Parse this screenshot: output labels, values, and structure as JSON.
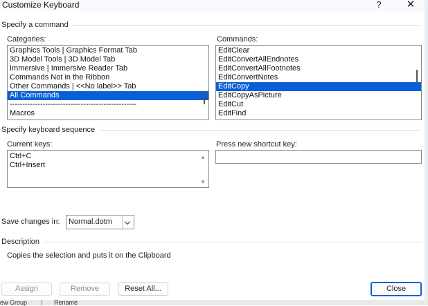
{
  "window": {
    "title": "Customize Keyboard",
    "help_glyph": "?",
    "close_glyph": "✕"
  },
  "specify_command": {
    "heading": "Specify a command",
    "categories_label": "Categories:",
    "categories": [
      "Graphics Tools | Graphics Format Tab",
      "3D Model Tools | 3D Model Tab",
      "Immersive | Immersive Reader Tab",
      "Commands Not in the Ribbon",
      "Other Commands | <<No label>> Tab",
      "All Commands",
      "--------------------------------------------------",
      "Macros"
    ],
    "categories_selected_index": 5,
    "commands_label": "Commands:",
    "commands": [
      "EditClear",
      "EditConvertAllEndnotes",
      "EditConvertAllFootnotes",
      "EditConvertNotes",
      "EditCopy",
      "EditCopyAsPicture",
      "EditCut",
      "EditFind"
    ],
    "commands_selected_index": 4
  },
  "keyboard_sequence": {
    "heading": "Specify keyboard sequence",
    "current_keys_label": "Current keys:",
    "current_keys": [
      "Ctrl+C",
      "Ctrl+Insert"
    ],
    "new_key_label": "Press new shortcut key:",
    "new_key_value": ""
  },
  "save_changes": {
    "label": "Save changes in:",
    "value": "Normal.dotm"
  },
  "description": {
    "heading": "Description",
    "text": "Copies the selection and puts it on the Clipboard"
  },
  "buttons": {
    "assign": "Assign",
    "remove": "Remove",
    "reset_all": "Reset All...",
    "close": "Close"
  },
  "background_window": {
    "left_fragment": "ew Group",
    "right_fragment": "Rename"
  },
  "colors": {
    "selection": "#0a5fd6",
    "default_button_border": "#0a5fd6"
  }
}
